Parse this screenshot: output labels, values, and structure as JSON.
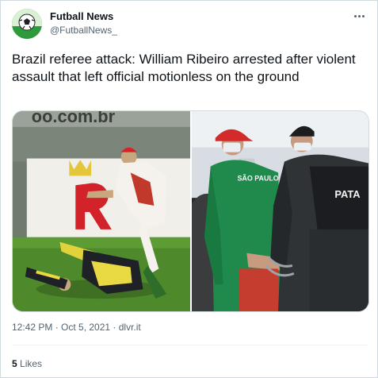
{
  "author": {
    "name": "Futball News",
    "handle": "@FutballNews_",
    "avatar_icon": "soccer-ball-icon"
  },
  "tweet": {
    "text": "Brazil referee attack: William Ribeiro arrested after violent assault that left official motionless on the ground",
    "timestamp": "12:42 PM · Oct 5, 2021 · dlvr.it",
    "likes_count": "5",
    "likes_label": "Likes"
  },
  "media": {
    "left_photo": {
      "icon": "referee-attack-photo",
      "signage": "oo.com.br"
    },
    "right_photo": {
      "icon": "player-arrest-photo",
      "shirt_text": "SÃO PAULO",
      "vest_text": "PATA"
    }
  },
  "colors": {
    "text": "#0f1419",
    "secondary": "#536471",
    "border": "#cfd9de"
  }
}
